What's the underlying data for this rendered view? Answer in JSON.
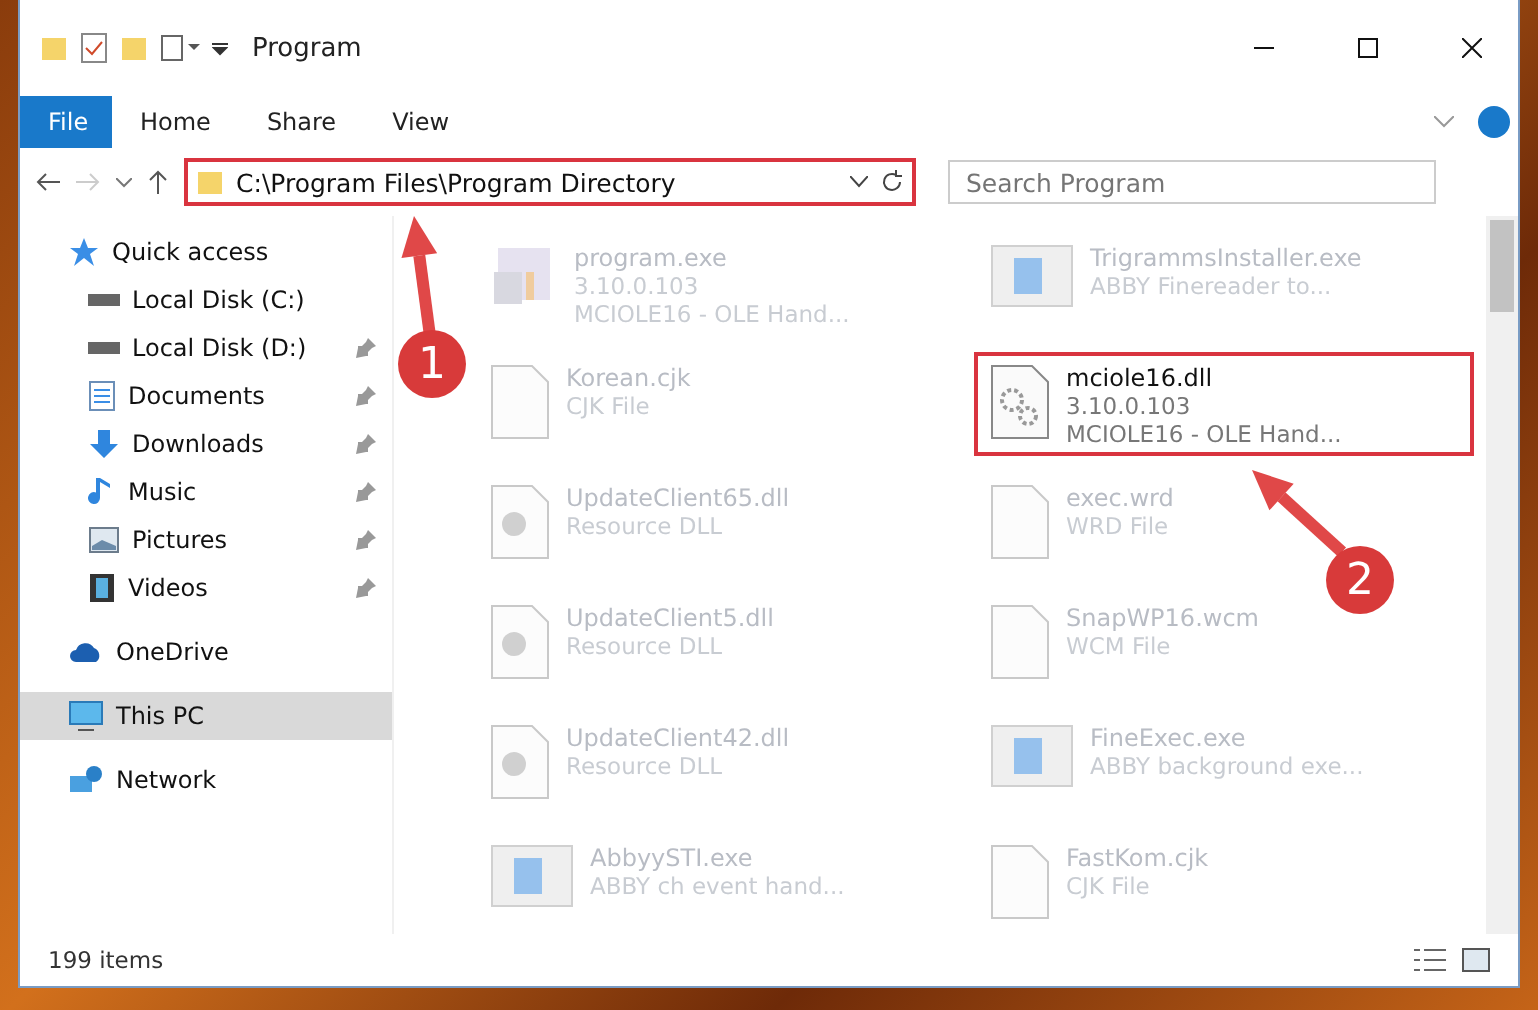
{
  "window": {
    "title": "Program"
  },
  "ribbon_tabs": [
    {
      "label": "File",
      "selected": true
    },
    {
      "label": "Home",
      "selected": false
    },
    {
      "label": "Share",
      "selected": false
    },
    {
      "label": "View",
      "selected": false
    }
  ],
  "address": {
    "path": "C:\\Program Files\\Program Directory",
    "highlighted": true
  },
  "search": {
    "placeholder": "Search Program"
  },
  "nav": [
    {
      "label": "Quick access",
      "kind": "star",
      "selected": false,
      "pinned": false,
      "children": [
        {
          "label": "Local Disk (C:)",
          "kind": "drive",
          "selected": false,
          "pinned": false
        },
        {
          "label": "Local Disk (D:)",
          "kind": "drive",
          "selected": false,
          "pinned": true
        },
        {
          "label": "Documents",
          "kind": "doc",
          "selected": false,
          "pinned": true
        },
        {
          "label": "Downloads",
          "kind": "down",
          "selected": false,
          "pinned": true
        },
        {
          "label": "Music",
          "kind": "music",
          "selected": false,
          "pinned": true
        },
        {
          "label": "Pictures",
          "kind": "pic",
          "selected": false,
          "pinned": true
        },
        {
          "label": "Videos",
          "kind": "video",
          "selected": false,
          "pinned": true
        }
      ]
    },
    {
      "label": "OneDrive",
      "kind": "cloud",
      "selected": false,
      "pinned": false
    },
    {
      "label": "This PC",
      "kind": "pc",
      "selected": true,
      "pinned": false
    },
    {
      "label": "Network",
      "kind": "net",
      "selected": false,
      "pinned": false
    }
  ],
  "files": [
    {
      "name": "program.exe",
      "lines": [
        "3.10.0.103",
        "MCIOLE16 - OLE Hand..."
      ],
      "kind": "setup",
      "faded": true,
      "highlighted": false
    },
    {
      "name": "TrigrammsInstaller.exe",
      "lines": [
        "ABBY Finereader to..."
      ],
      "kind": "app",
      "faded": true,
      "highlighted": false
    },
    {
      "name": "Korean.cjk",
      "lines": [
        "CJK File"
      ],
      "kind": "blank",
      "faded": true,
      "highlighted": false
    },
    {
      "name": "mciole16.dll",
      "lines": [
        "3.10.0.103",
        "MCIOLE16 - OLE Hand..."
      ],
      "kind": "gear",
      "faded": false,
      "highlighted": true
    },
    {
      "name": "UpdateClient65.dll",
      "lines": [
        "Resource DLL"
      ],
      "kind": "dll",
      "faded": true,
      "highlighted": false
    },
    {
      "name": "exec.wrd",
      "lines": [
        "WRD File"
      ],
      "kind": "blank",
      "faded": true,
      "highlighted": false
    },
    {
      "name": "UpdateClient5.dll",
      "lines": [
        "Resource DLL"
      ],
      "kind": "dll",
      "faded": true,
      "highlighted": false
    },
    {
      "name": "SnapWP16.wcm",
      "lines": [
        "WCM File"
      ],
      "kind": "blank",
      "faded": true,
      "highlighted": false
    },
    {
      "name": "UpdateClient42.dll",
      "lines": [
        "Resource DLL"
      ],
      "kind": "dll",
      "faded": true,
      "highlighted": false
    },
    {
      "name": "FineExec.exe",
      "lines": [
        "ABBY background exe..."
      ],
      "kind": "app",
      "faded": true,
      "highlighted": false
    },
    {
      "name": "AbbyySTI.exe",
      "lines": [
        "ABBY ch event hand..."
      ],
      "kind": "app",
      "faded": true,
      "highlighted": false
    },
    {
      "name": "FastKom.cjk",
      "lines": [
        "CJK File"
      ],
      "kind": "blank",
      "faded": true,
      "highlighted": false
    }
  ],
  "status_bar": {
    "count": "199 items"
  },
  "callouts": [
    {
      "number": "1"
    },
    {
      "number": "2"
    }
  ]
}
